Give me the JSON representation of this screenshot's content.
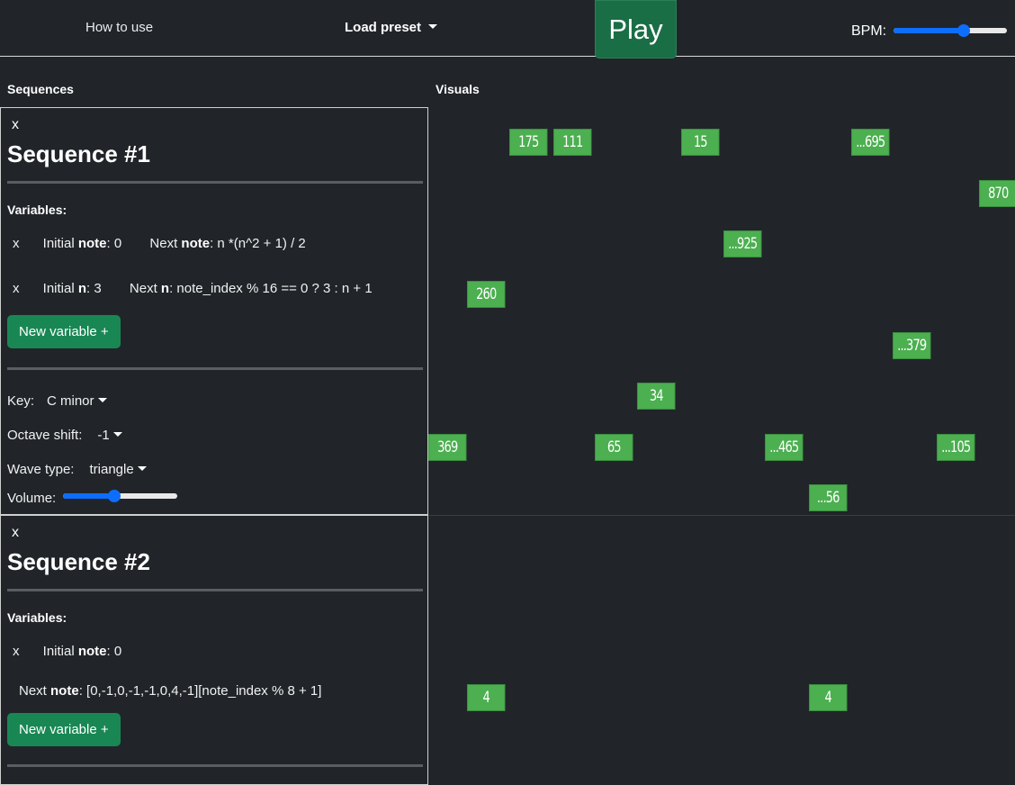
{
  "nav": {
    "how_to_use": "How to use",
    "load_preset": "Load preset",
    "play": "Play",
    "bpm_label": "BPM:",
    "bpm_level": 0.62
  },
  "columns": {
    "sequences": "Sequences",
    "visuals": "Visuals"
  },
  "sequences": [
    {
      "close": "x",
      "title": "Sequence #1",
      "variables_label": "Variables:",
      "variables": [
        {
          "remove": "x",
          "initial_pre": "Initial ",
          "name": "note",
          "initial_val": ": 0",
          "next_pre": "Next ",
          "next_name": "note",
          "next_expr": ": n *(n^2 + 1) / 2"
        },
        {
          "remove": "x",
          "initial_pre": "Initial ",
          "name": "n",
          "initial_val": ": 3",
          "next_pre": "Next ",
          "next_name": "n",
          "next_expr": ": note_index % 16 == 0 ? 3 : n + 1"
        }
      ],
      "new_variable": "New variable +",
      "key_label": "Key:",
      "key_value": "C minor",
      "octave_label": "Octave shift:",
      "octave_value": "-1",
      "wave_label": "Wave type:",
      "wave_value": "triangle",
      "volume_label": "Volume:",
      "volume_level": 0.45
    },
    {
      "close": "x",
      "title": "Sequence #2",
      "variables_label": "Variables:",
      "variables": [
        {
          "remove": "x",
          "initial_pre": "Initial ",
          "name": "note",
          "initial_val": ": 0"
        }
      ],
      "next_line": {
        "pre": "Next ",
        "name": "note",
        "expr": ": [0,-1,0,-1,-1,0,4,-1][note_index % 8 + 1]"
      },
      "new_variable": "New variable +"
    }
  ],
  "visual_notes_1": [
    "175",
    "111",
    "15",
    "...695",
    "870",
    "...925",
    "260",
    "...379",
    "34",
    "369",
    "65",
    "...465",
    "...105",
    "...56"
  ],
  "visual_notes_2": [
    "4",
    "4"
  ]
}
